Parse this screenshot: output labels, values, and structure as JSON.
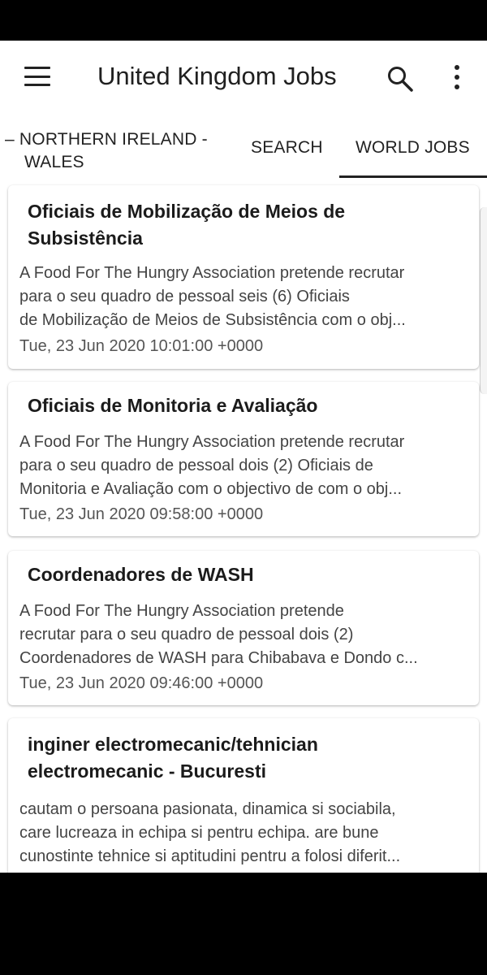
{
  "app_bar": {
    "title": "United Kingdom Jobs",
    "menu_icon": "hamburger-menu-icon",
    "search_icon": "search-icon",
    "more_icon": "more-vert-icon"
  },
  "tabs": [
    {
      "line1": "– NORTHERN IRELAND -",
      "line2": "WALES"
    },
    {
      "label": "SEARCH"
    },
    {
      "label": "WORLD JOBS",
      "selected": true
    }
  ],
  "jobs": [
    {
      "title": "Oficiais de Mobilização de Meios de Subsistência",
      "desc_lines": [
        "A Food For The Hungry Association pretende recrutar",
        "para o seu quadro de pessoal seis (6) Oficiais",
        "de Mobilização de Meios de Subsistência com o obj..."
      ],
      "date": "Tue, 23 Jun 2020 10:01:00 +0000"
    },
    {
      "title": "Oficiais de Monitoria e Avaliação",
      "desc_lines": [
        "A Food For The Hungry Association pretende recrutar",
        "para o seu quadro de pessoal dois (2) Oficiais de",
        "Monitoria e Avaliação com o objectivo de com o obj..."
      ],
      "date": "Tue, 23 Jun 2020 09:58:00 +0000"
    },
    {
      "title": "Coordenadores de WASH",
      "desc_lines": [
        "A Food For The Hungry Association pretende",
        "recrutar para o seu quadro de pessoal dois (2)",
        "Coordenadores de WASH para Chibabava e Dondo c..."
      ],
      "date": "Tue, 23 Jun 2020 09:46:00 +0000"
    },
    {
      "title": "inginer electromecanic/tehnician electromecanic - Bucuresti",
      "desc_lines": [
        "cautam o persoana pasionata, dinamica si sociabila,",
        "care lucreaza in echipa si pentru echipa. are bune",
        "cunostinte tehnice si aptitudini pentru a folosi diferit..."
      ],
      "date": ""
    }
  ]
}
